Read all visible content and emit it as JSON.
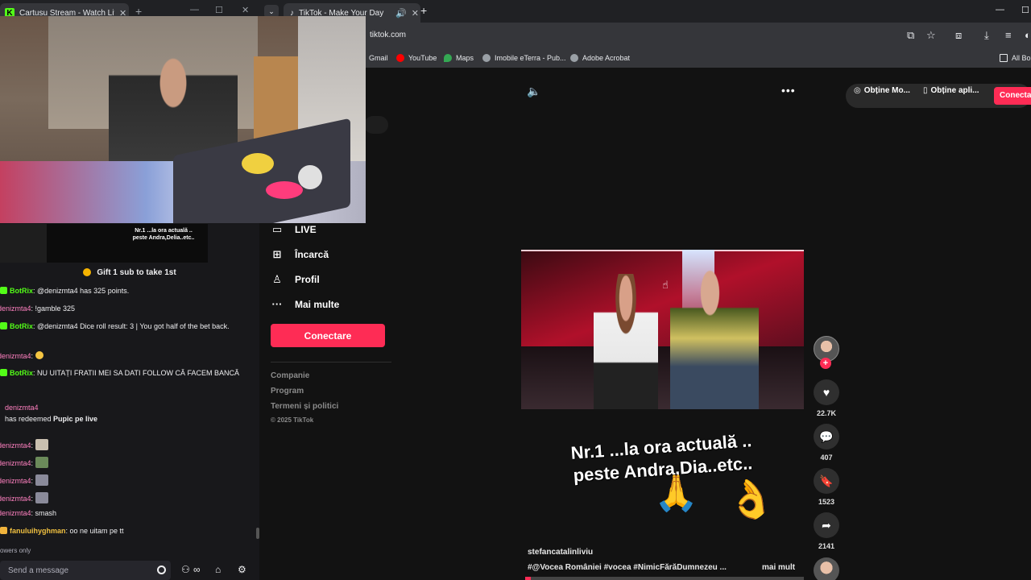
{
  "left_browser": {
    "tab_title": "Cartusu Stream - Watch Live on Kick",
    "tab_icon": "K",
    "minimize": "—",
    "maximize": "☐",
    "close": "✕",
    "new_tab": "+",
    "preview_text": "Nr.1 ...la ora actuală .. peste Andra,Delia..etc..",
    "chat_header": "Gift 1 sub to take 1st",
    "chat": [
      {
        "user": "BotRix",
        "text": ": @denizmta4 has 325 points."
      },
      {
        "user": "denizmta4",
        "text": ": !gamble 325"
      },
      {
        "user": "BotRix",
        "text": ": @denizmta4 Dice roll result: 3 | You got half of the bet back."
      },
      {
        "user": "denizmta4",
        "text": ":"
      },
      {
        "user": "BotRix",
        "text": ": NU UITAȚI FRATII MEI SA DATI FOLLOW CĂ FACEM BANCĂ"
      },
      {
        "user": "denizmta4",
        "text": ""
      },
      {
        "user": "",
        "text": "has redeemed ",
        "bold": "Pupic pe live"
      },
      {
        "user": "denizmta4",
        "text": ":"
      },
      {
        "user": "denizmta4",
        "text": ":"
      },
      {
        "user": "denizmta4",
        "text": ":"
      },
      {
        "user": "denizmta4",
        "text": ":"
      },
      {
        "user": "denizmta4",
        "text": ": smash"
      },
      {
        "user": "fanuluihyghman",
        "text": ": oo ne uitam pe tt"
      }
    ],
    "followers_only": "owers only",
    "send_placeholder": "Send a message"
  },
  "right_browser": {
    "tab_title": "TikTok - Make Your Day",
    "url": "tiktok.com",
    "bookmarks": [
      {
        "label": "Gmail",
        "color": "#ea4335"
      },
      {
        "label": "YouTube",
        "color": "#ff0000"
      },
      {
        "label": "Maps",
        "color": "#34a853"
      },
      {
        "label": "Imobile eTerra - Pub...",
        "color": "#9aa0a6"
      },
      {
        "label": "Adobe Acrobat",
        "color": "#9aa0a6"
      },
      {
        "label": "All Bo",
        "color": "#9aa0a6"
      }
    ],
    "nav": [
      {
        "label": "LIVE",
        "icon": "📺"
      },
      {
        "label": "Încarcă",
        "icon": "⊞"
      },
      {
        "label": "Profil",
        "icon": "👤"
      },
      {
        "label": "Mai multe",
        "icon": "···"
      }
    ],
    "login_button": "Conectare",
    "footer_links": [
      "Companie",
      "Program",
      "Termeni și politici"
    ],
    "copyright": "© 2025 TikTok",
    "top_actions": [
      "Obține Mo...",
      "Obține apli..."
    ],
    "top_login": "Conecta",
    "video_overlay_line1": "Nr.1 ...la ora actuală ..",
    "video_overlay_line2": "peste Andra,D",
    "video_overlay_line3": "ia..etc..",
    "author": "stefancatalinliviu",
    "hashtags": "#@Vocea României  #vocea  #NimicFărăDumnezeu  ...",
    "more": "mai mult",
    "stats": {
      "likes": "22.7K",
      "comments": "407",
      "saves": "1523",
      "shares": "2141"
    },
    "progress": 0.02,
    "accent": "#fe2c55"
  }
}
